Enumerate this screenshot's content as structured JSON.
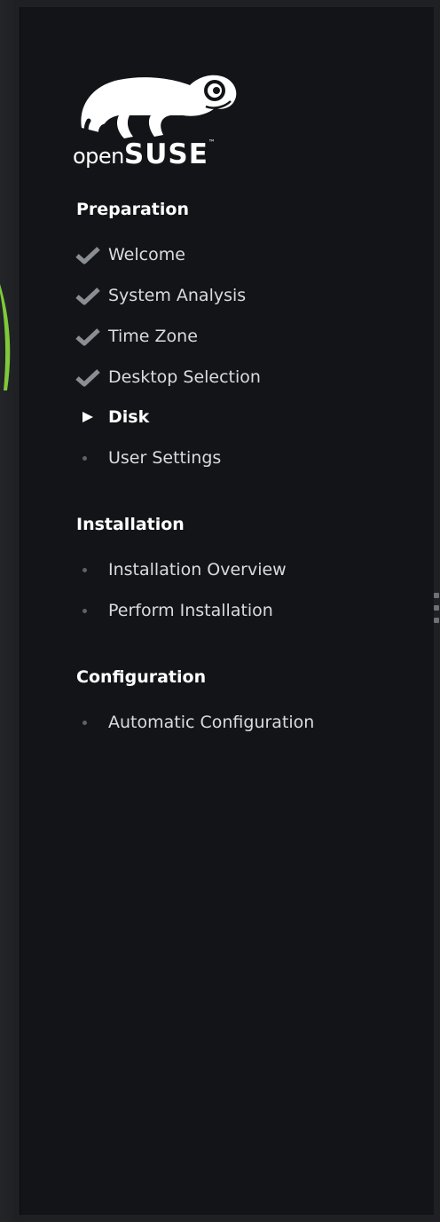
{
  "logo": {
    "open": "open",
    "suse": "SUSE",
    "tm": "™"
  },
  "sections": [
    {
      "title": "Preparation",
      "steps": [
        {
          "label": "Welcome",
          "state": "done"
        },
        {
          "label": "System Analysis",
          "state": "done"
        },
        {
          "label": "Time Zone",
          "state": "done"
        },
        {
          "label": "Desktop Selection",
          "state": "done"
        },
        {
          "label": "Disk",
          "state": "current"
        },
        {
          "label": "User Settings",
          "state": "pending"
        }
      ]
    },
    {
      "title": "Installation",
      "steps": [
        {
          "label": "Installation Overview",
          "state": "pending"
        },
        {
          "label": "Perform Installation",
          "state": "pending"
        }
      ]
    },
    {
      "title": "Configuration",
      "steps": [
        {
          "label": "Automatic Configuration",
          "state": "pending"
        }
      ]
    }
  ],
  "colors": {
    "panel": "#121417",
    "accent_green": "#73ba25",
    "checkmark": "#8a8e92"
  }
}
